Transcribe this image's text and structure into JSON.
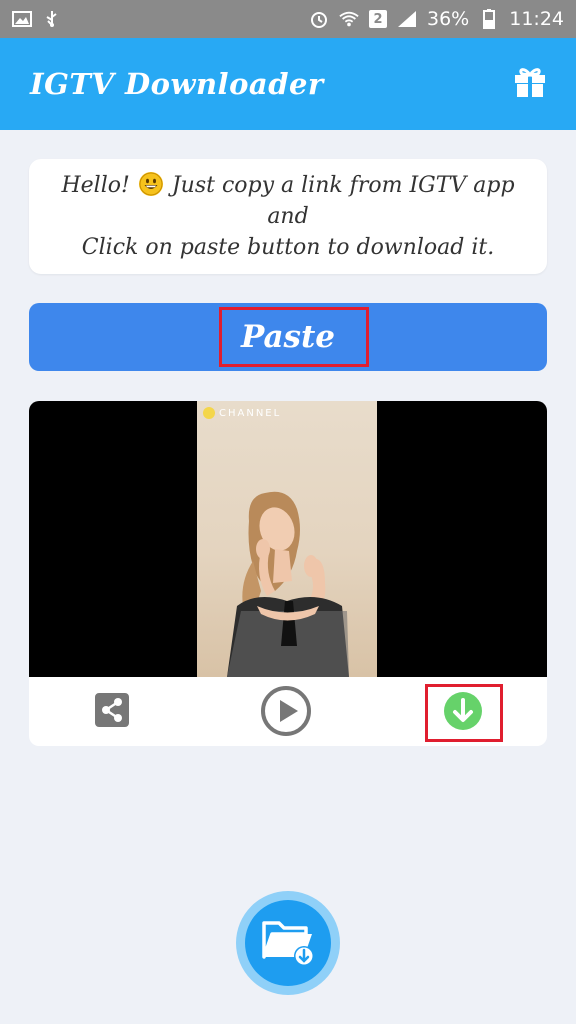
{
  "status_bar": {
    "battery": "36%",
    "time": "11:24",
    "sim_badge": "2",
    "left_icons": [
      "image-icon",
      "usb-icon"
    ],
    "right_icons": [
      "alarm-icon",
      "wifi-icon",
      "signal-icon",
      "battery-icon"
    ]
  },
  "app_bar": {
    "title": "IGTV Downloader",
    "action_icon": "gift-icon"
  },
  "message": {
    "line1_before_emoji": "Hello!",
    "line1_after_emoji": "Just copy a link from IGTV app and",
    "line2": "Click on paste button to download it.",
    "emoji": "grinning-face-emoji"
  },
  "paste_button": {
    "label": "Paste"
  },
  "video": {
    "channel_tag": "CHANNEL",
    "controls": [
      "share-icon",
      "play-icon",
      "download-icon"
    ]
  },
  "fab": {
    "icon": "folder-download-icon"
  },
  "colors": {
    "app_bar": "#28a9f4",
    "paste_button": "#3e87ec",
    "highlight": "#e01e2f",
    "download": "#66d26a",
    "fab": "#1e9df0"
  }
}
